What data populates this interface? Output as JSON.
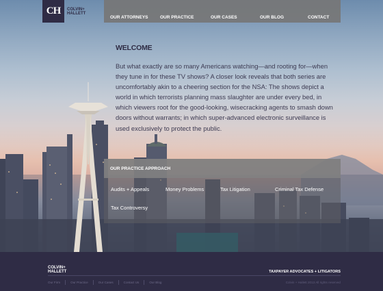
{
  "logo": {
    "mark": "CH",
    "line1": "COLVIN+",
    "line2": "HALLETT"
  },
  "nav": {
    "items": [
      "OUR ATTORNEYS",
      "OUR PRACTICE",
      "OUR CASES",
      "OUR BLOG",
      "CONTACT"
    ]
  },
  "welcome": {
    "title": "WELCOME",
    "body": "But what exactly are so many Americans watching—and rooting for—when they tune in for these TV shows? A closer look reveals that both series are uncomfortably akin to a cheering section for the NSA: The shows depict a world in which terrorists planning mass slaughter are under every bed, in which viewers root for the good-looking, wisecracking agents to smash down doors without warrants; in which super-advanced electronic surveillance is used exclusively to protect the public."
  },
  "practice": {
    "header": "OUR PRACTICE APPROACH",
    "links": [
      "Audits + Appeals",
      "Money Problems",
      "Tax Litigation",
      "Criminal Tax Defense",
      "Tax Controversy"
    ]
  },
  "footer": {
    "logo_line1": "COLVIN+",
    "logo_line2": "HALLETT",
    "tagline": "TAXPAYER ADVOCATES + LITIGATORS",
    "links": [
      "Our Firm",
      "Our Practice",
      "Our Cases",
      "Contact Us",
      "Our Blog"
    ],
    "copyright": "Colvin + Hallett 2013 All rights reserved"
  },
  "colors": {
    "brand_dark": "#2f2c45",
    "nav_gray": "#767676"
  }
}
